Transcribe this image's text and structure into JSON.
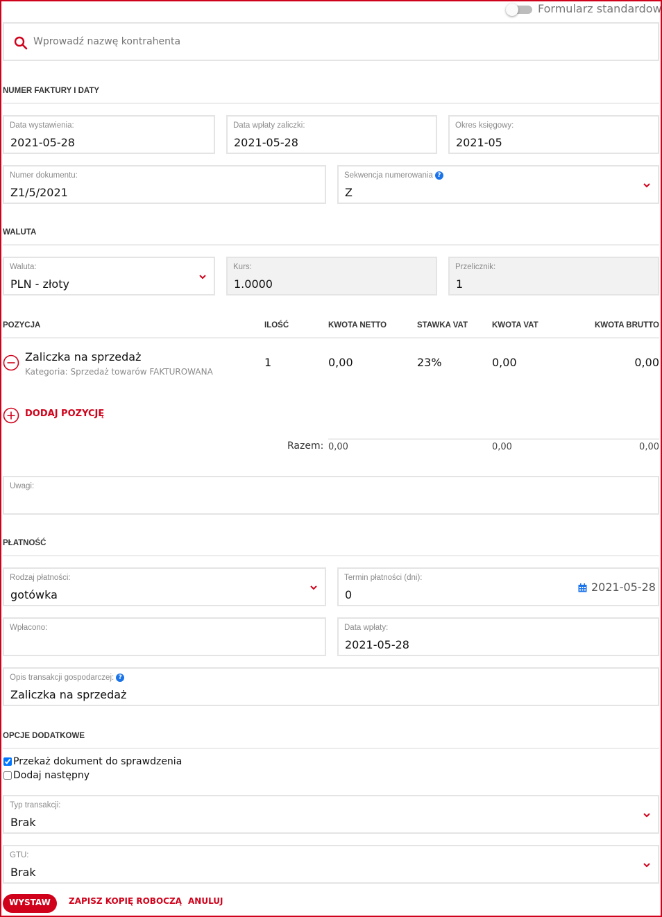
{
  "toggle": {
    "label": "Formularz standardowy",
    "on": false
  },
  "search": {
    "placeholder": "Wprowadź nazwę kontrahenta"
  },
  "sections": {
    "invoice": "NUMER FAKTURY I DATY",
    "currency": "WALUTA",
    "payment": "PŁATNOŚĆ",
    "options": "OPCJE DODATKOWE"
  },
  "dates": {
    "issue_label": "Data wystawienia:",
    "issue_value": "2021-05-28",
    "advance_label": "Data wpłaty zaliczki:",
    "advance_value": "2021-05-28",
    "period_label": "Okres księgowy:",
    "period_value": "2021-05"
  },
  "document": {
    "number_label": "Numer dokumentu:",
    "number_value": "Z1/5/2021",
    "sequence_label": "Sekwencja numerowania",
    "sequence_value": "Z"
  },
  "currency": {
    "currency_label": "Waluta:",
    "currency_value": "PLN - złoty",
    "rate_label": "Kurs:",
    "rate_value": "1.0000",
    "converter_label": "Przelicznik:",
    "converter_value": "1"
  },
  "table": {
    "headers": {
      "position": "POZYCJA",
      "qty": "ILOŚĆ",
      "net": "KWOTA NETTO",
      "vat_rate": "STAWKA VAT",
      "vat": "KWOTA VAT",
      "gross": "KWOTA BRUTTO"
    },
    "row": {
      "name": "Zaliczka na sprzedaż",
      "category": "Kategoria: Sprzedaż towarów FAKTUROWANA",
      "qty": "1",
      "net": "0,00",
      "vat_rate": "23%",
      "vat": "0,00",
      "gross": "0,00"
    },
    "add_label": "DODAJ POZYCJĘ",
    "sum_label": "Razem:",
    "sum_net": "0,00",
    "sum_vat": "0,00",
    "sum_gross": "0,00"
  },
  "notes": {
    "label": "Uwagi:"
  },
  "payment": {
    "type_label": "Rodzaj płatności:",
    "type_value": "gotówka",
    "term_label": "Termin płatności (dni):",
    "term_value": "0",
    "term_date": "2021-05-28",
    "paid_label": "Wpłacono:",
    "paid_date_label": "Data wpłaty:",
    "paid_date_value": "2021-05-28",
    "desc_label": "Opis transakcji gospodarczej:",
    "desc_value": "Zaliczka na sprzedaż"
  },
  "options": {
    "check_label": "Przekaż dokument do sprawdzenia",
    "check_checked": true,
    "next_label": "Dodaj następny",
    "next_checked": false,
    "transaction_label": "Typ transakcji:",
    "transaction_value": "Brak",
    "gtu_label": "GTU:",
    "gtu_value": "Brak"
  },
  "buttons": {
    "issue": "WYSTAW",
    "draft": "ZAPISZ KOPIĘ ROBOCZĄ",
    "cancel": "ANULUJ"
  },
  "colors": {
    "accent": "#d0021b",
    "info": "#1a73e8",
    "border": "#e4e4e4"
  }
}
